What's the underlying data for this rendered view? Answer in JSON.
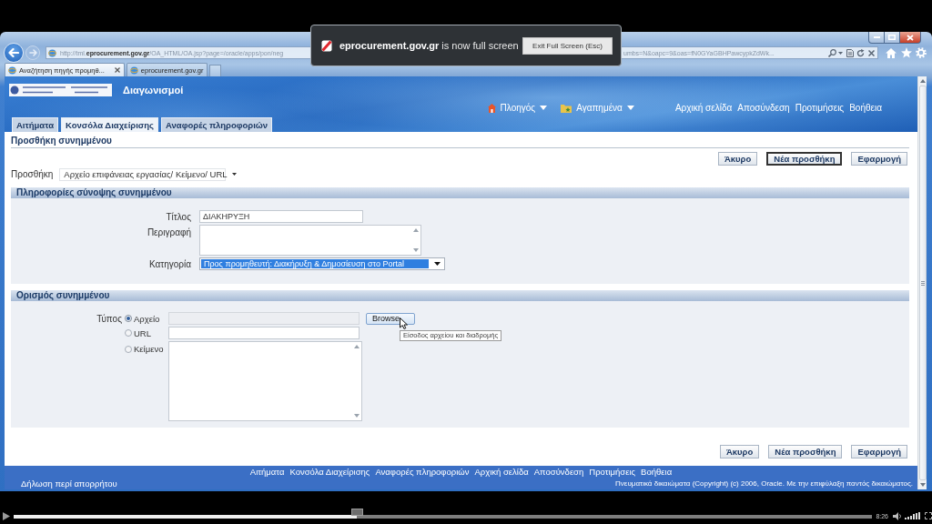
{
  "browser": {
    "address": "http://tml.**eprocurement.gov.gr**/OA_HTML/OA.jsp?page=/oracle/apps/pon/neg",
    "address_tail": "umbs=N&oapc=9&oas=fN0GYaGBHPawcypkZdWk...",
    "tabs": [
      {
        "label": "Αναζήτηση πηγής προμηθ...",
        "selected": true
      },
      {
        "label": "eprocurement.gov.gr",
        "selected": false
      }
    ]
  },
  "fullscreen_notice": {
    "message": "**eprocurement.gov.gr** is now full screen",
    "button": "Exit Full Screen (Esc)"
  },
  "app": {
    "title": "Διαγωνισμοί",
    "menus": [
      {
        "kind": "navigator",
        "label": "Πλοηγός"
      },
      {
        "kind": "favorites",
        "label": "Αγαπημένα"
      }
    ],
    "links": [
      "Αρχική σελίδα",
      "Αποσύνδεση",
      "Προτιμήσεις",
      "Βοήθεια"
    ],
    "tabs": [
      {
        "label": "Αιτήματα",
        "selected": false
      },
      {
        "label": "Κονσόλα Διαχείρισης",
        "selected": true
      },
      {
        "label": "Αναφορές πληροφοριών",
        "selected": false
      }
    ]
  },
  "page": {
    "title": "Προσθήκη συνημμένου",
    "buttons_top": [
      {
        "label": "Άκυρο",
        "default": false
      },
      {
        "label": "Νέα προσθήκη",
        "default": true
      },
      {
        "label": "Εφαρμογή",
        "default": false
      }
    ],
    "add": {
      "label": "Προσθήκη",
      "value": "Αρχείο επιφάνειας εργασίας/ Κείμενο/ URL"
    },
    "summary": {
      "title": "Πληροφορίες σύνοψης συνημμένου",
      "fields": [
        {
          "kind": "text",
          "label": "Τίτλος",
          "value": "ΔΙΑΚΗΡΥΞΗ"
        },
        {
          "kind": "textarea",
          "label": "Περιγραφή"
        },
        {
          "kind": "select",
          "label": "Κατηγορία",
          "value": "Προς προμηθευτή: Διακήρυξη & Δημοσίευση στο Portal",
          "highlighted": true
        }
      ]
    },
    "definition": {
      "title": "Ορισμός συνημμένου",
      "type_label": "Τύπος",
      "options": [
        {
          "kind": "file",
          "label": "Αρχείο",
          "selected": true,
          "button": "Browse",
          "tooltip": "Είσοδος αρχείου και διαδρομής"
        },
        {
          "kind": "url",
          "label": "URL",
          "selected": false
        },
        {
          "kind": "text",
          "label": "Κείμενο",
          "selected": false
        }
      ]
    },
    "buttons_bottom": [
      {
        "label": "Άκυρο",
        "default": false
      },
      {
        "label": "Νέα προσθήκη",
        "default": false
      },
      {
        "label": "Εφαρμογή",
        "default": false
      }
    ]
  },
  "footer": {
    "links": [
      "Αιτήματα",
      "Κονσόλα Διαχείρισης",
      "Αναφορές πληροφοριών",
      "Αρχική σελίδα",
      "Αποσύνδεση",
      "Προτιμήσεις",
      "Βοήθεια"
    ],
    "privacy": "Δήλωση περί απορρήτου",
    "copyright": "Πνευματικά δικαιώματα (Copyright) (c) 2006, Oracle. Με την επιφύλαξη παντός δικαιώματος."
  },
  "player": {
    "progress": {
      "level": 0.4
    },
    "time": "8:26"
  }
}
